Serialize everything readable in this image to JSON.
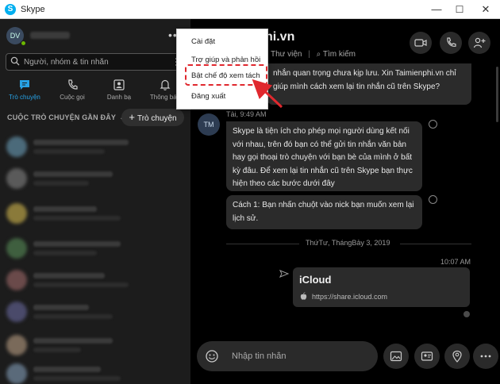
{
  "window": {
    "title": "Skype",
    "logo_letter": "S",
    "minimize": "—",
    "maximize": "☐",
    "close": "✕"
  },
  "sidebar": {
    "profile_initials": "DV",
    "more": "•••",
    "search_placeholder": "Người, nhóm & tin nhắn",
    "nav": [
      {
        "label": "Trò chuyện",
        "icon": "chat-icon",
        "active": true
      },
      {
        "label": "Cuộc gọi",
        "icon": "phone-icon",
        "active": false
      },
      {
        "label": "Danh bạ",
        "icon": "contacts-icon",
        "active": false
      },
      {
        "label": "Thông báo",
        "icon": "bell-icon",
        "active": false
      }
    ],
    "recent_label": "CUỘC TRÒ CHUYỆN GẦN ĐÂY",
    "new_chat_label": "Trò chuyện",
    "new_chat_icon": "+"
  },
  "menu": {
    "items": [
      "Cài đặt",
      "Trợ giúp và phản hồi",
      "Bật chế độ xem tách",
      "Đăng xuất"
    ],
    "highlighted": "Bật chế độ xem tách"
  },
  "chat": {
    "title": "hi.vn",
    "gallery_label": "Thư viện",
    "search_label": "Tìm kiếm",
    "separator": "|",
    "top_message": "nhắn quan trọng chưa kịp lưu. Xin Taimienphi.vn chỉ giúp mình cách xem lại tin nhắn cũ trên Skype?",
    "sender_meta": "Tải, 9:49 AM",
    "sender_initials": "TM",
    "message_1": "Skype là tiện ích cho phép mọi người dùng kết nối với nhau, trên đó bạn có thể gửi tin nhắn văn bản hay gọi thoại trò chuyện với bạn bè của mình ở bất kỳ đâu. Để xem lại tin nhắn cũ trên Skype bạn thực hiện theo các bước dưới đây",
    "message_2": "Cách 1: Bạn nhấn chuột vào nick bạn muốn xem lại lịch sử.",
    "date_separator": "ThứTư, ThángBảy 3, 2019",
    "sent_time": "10:07 AM",
    "link_card": {
      "title": "iCloud",
      "url": "https://share.icloud.com"
    },
    "composer_placeholder": "Nhập tin nhắn"
  },
  "colors": {
    "accent": "#27a2e6",
    "highlight": "#e0282e",
    "sidebar_bg": "#1c1c1c",
    "bubble_bg": "#2b2b2b"
  }
}
